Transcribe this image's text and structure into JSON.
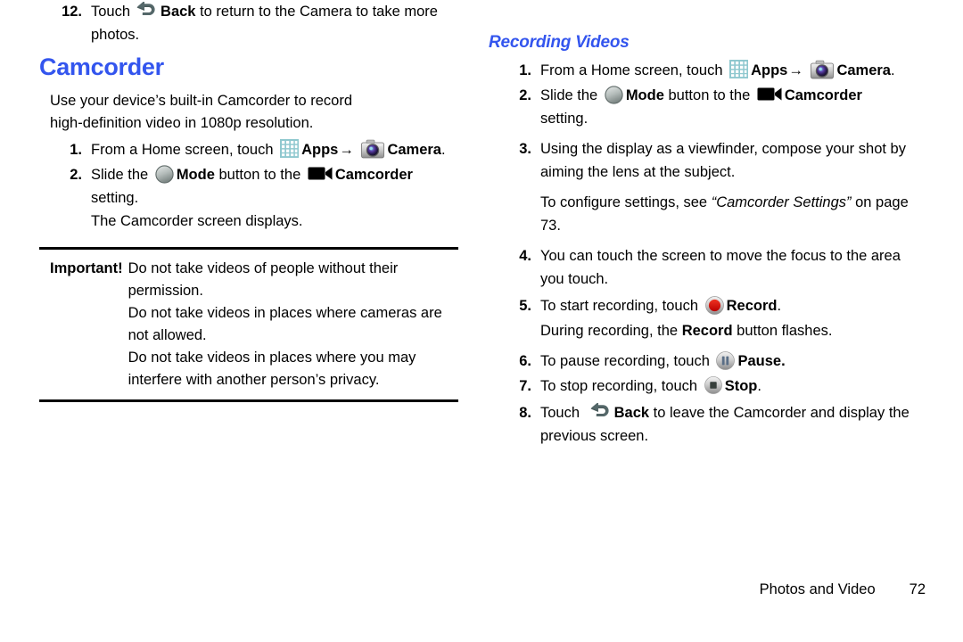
{
  "document": {
    "left_column": {
      "step12": {
        "num": "12.",
        "text_1": "Touch",
        "bold_back": "Back",
        "text_2": "to return to the Camera to take more photos."
      },
      "heading": "Camcorder",
      "intro": "Use your device’s built-in Camcorder to record high-definition video in 1080p resolution.",
      "steps": [
        {
          "num": "1.",
          "text_1": "From a Home screen, touch",
          "bold_apps": "Apps",
          "arrow": "→",
          "bold_camera": "Camera",
          "text_2": "."
        },
        {
          "num": "2.",
          "text_1": "Slide the",
          "bold_mode": "Mode",
          "text_2": "button to the",
          "bold_camcorder": "Camcorder",
          "text_3": "setting.",
          "sub_text": "The Camcorder screen displays."
        }
      ],
      "important": {
        "label": "Important!",
        "lines": [
          "Do not take videos of people without their permission.",
          "Do not take videos in places where cameras are not allowed.",
          "Do not take videos in places where you may interfere with another person’s privacy."
        ]
      }
    },
    "right_column": {
      "heading": "Recording Videos",
      "steps": [
        {
          "num": "1.",
          "text_1": "From a Home screen, touch",
          "bold_apps": "Apps",
          "arrow": "→",
          "bold_camera": "Camera",
          "text_2": "."
        },
        {
          "num": "2.",
          "text_1": "Slide the",
          "bold_mode": "Mode",
          "text_2": "button to the",
          "bold_camcorder": "Camcorder",
          "text_3": "setting."
        },
        {
          "num": "3.",
          "text_1": "Using the display as a viewfinder, compose your shot by aiming the lens at the subject.",
          "sub_text_1": "To configure settings, see",
          "sub_italic": "“Camcorder Settings”",
          "sub_text_2": "on page 73."
        },
        {
          "num": "4.",
          "text_1": "You can touch the screen to move the focus to the area you touch."
        },
        {
          "num": "5.",
          "text_1": "To start recording, touch",
          "bold_record": "Record",
          "text_2": ".",
          "sub_text_1": "During recording, the",
          "sub_bold": "Record",
          "sub_text_2": "button flashes."
        },
        {
          "num": "6.",
          "text_1": "To pause recording, touch",
          "bold_pause": "Pause."
        },
        {
          "num": "7.",
          "text_1": "To stop recording, touch",
          "bold_stop": "Stop",
          "text_2": "."
        },
        {
          "num": "8.",
          "text_1": "Touch",
          "bold_back": "Back",
          "text_2": "to leave the Camcorder and display the previous screen."
        }
      ]
    },
    "footer": {
      "section_label": "Photos and Video",
      "page_number": "72"
    },
    "colors": {
      "heading_blue": "#3355ee",
      "text_black": "#000000",
      "apps_icon_teal": "#8fc8cf",
      "record_red": "#dd1111",
      "rule_black": "#000000"
    },
    "icons": {
      "back": "back-arrow-icon",
      "apps": "apps-grid-icon",
      "camera": "camera-icon",
      "mode": "mode-circle-icon",
      "camcorder": "camcorder-icon",
      "record": "record-button-icon",
      "pause": "pause-button-icon",
      "stop": "stop-button-icon"
    }
  }
}
